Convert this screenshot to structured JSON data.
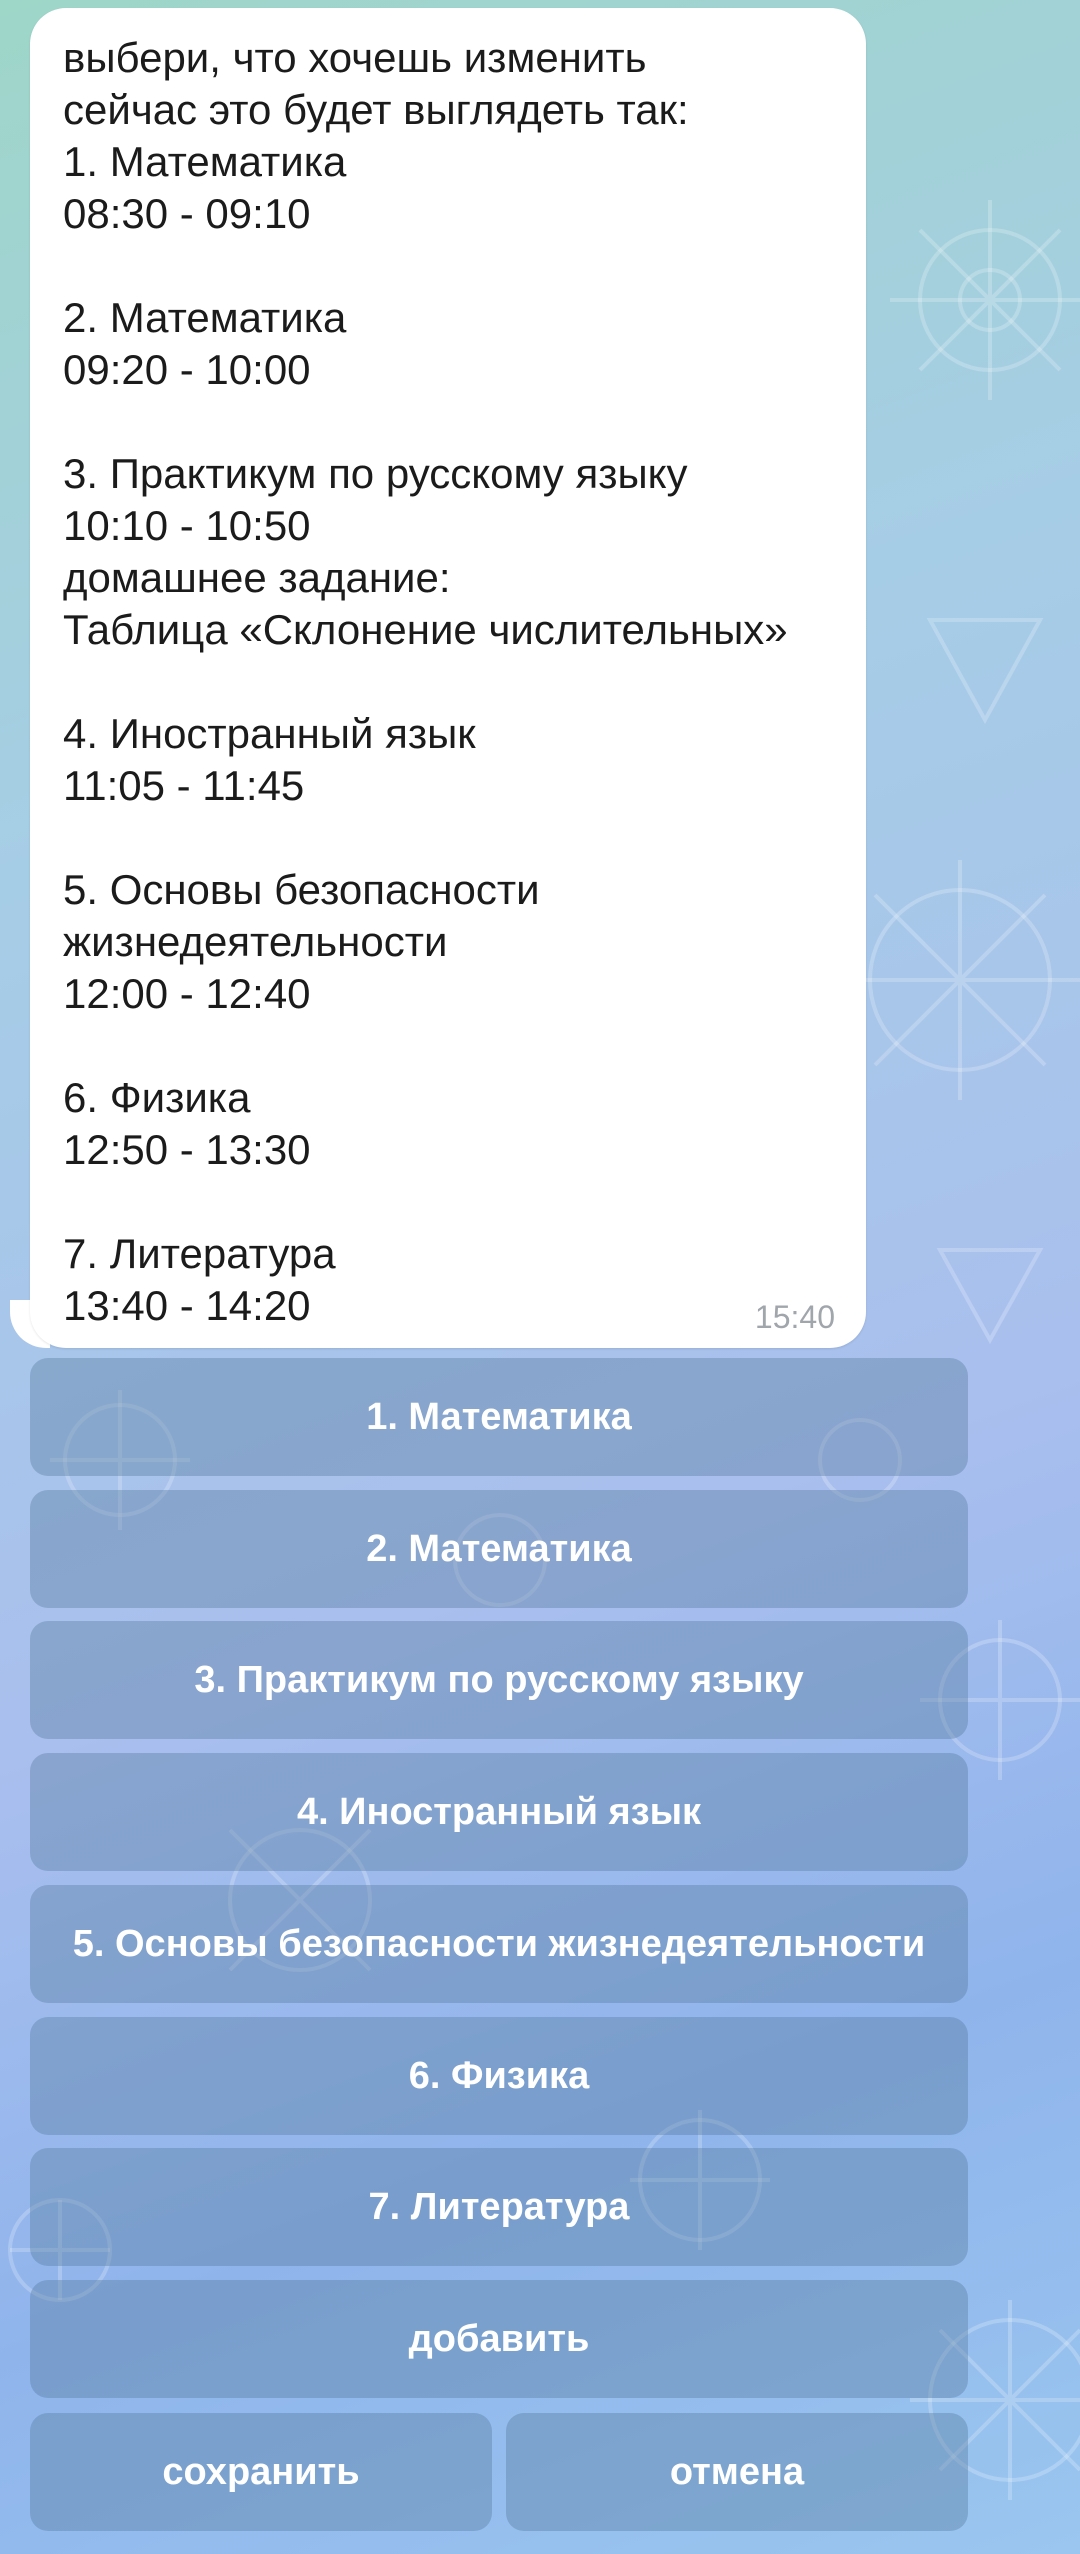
{
  "message": {
    "text": "выбери, что хочешь изменить\nсейчас это будет выглядеть так:\n1. Математика\n08:30 - 09:10\n\n2. Математика\n09:20 - 10:00\n\n3. Практикум по русскому языку\n10:10 - 10:50\nдомашнее задание:\nТаблица «Склонение числительных»\n\n4. Иностранный язык\n11:05 - 11:45\n\n5. Основы безопасности\nжизнедеятельности\n12:00 - 12:40\n\n6. Физика\n12:50 - 13:30\n\n7. Литература\n13:40 - 14:20",
    "time": "15:40"
  },
  "keyboard": {
    "buttons": [
      "1. Математика",
      "2. Математика",
      "3. Практикум по русскому языку",
      "4. Иностранный язык",
      "5. Основы безопасности жизнедеятельности",
      "6. Физика",
      "7. Литература",
      "добавить"
    ],
    "save_label": "сохранить",
    "cancel_label": "отмена"
  }
}
